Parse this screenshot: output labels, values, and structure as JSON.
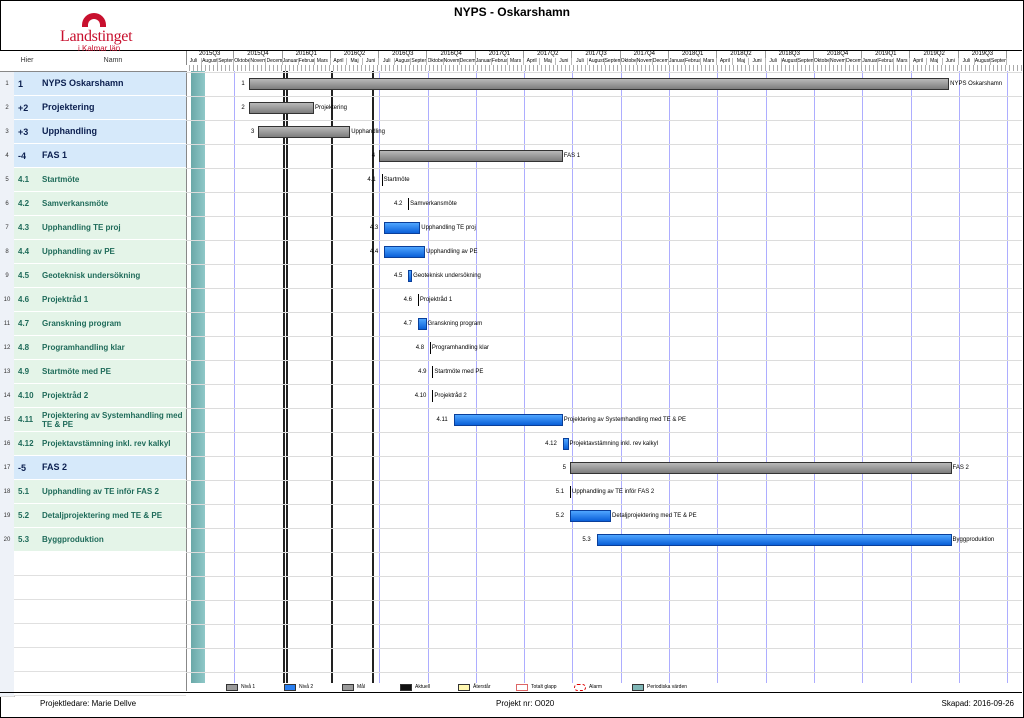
{
  "header": {
    "title": "NYPS - Oskarshamn",
    "logo_name": "Landstinget",
    "logo_sub": "i Kalmar län"
  },
  "columns": {
    "hier": "Hier",
    "name": "Namn"
  },
  "timeline": {
    "quarters": [
      "2015Q3",
      "2015Q4",
      "2016Q1",
      "2016Q2",
      "2016Q3",
      "2016Q4",
      "2017Q1",
      "2017Q2",
      "2017Q3",
      "2017Q4",
      "2018Q1",
      "2018Q2",
      "2018Q3",
      "2018Q4",
      "2019Q1",
      "2019Q2",
      "2019Q3"
    ],
    "months": [
      "Juli",
      "Augusti",
      "September",
      "Oktober",
      "November",
      "December",
      "Januari",
      "Februari",
      "Mars",
      "April",
      "Maj",
      "Juni"
    ]
  },
  "rows": [
    {
      "num": "1",
      "hier": "1",
      "name": "NYPS Oskarshamn",
      "level": 1,
      "expand": ""
    },
    {
      "num": "2",
      "hier": "2",
      "name": "Projektering",
      "level": 1,
      "expand": "+"
    },
    {
      "num": "3",
      "hier": "3",
      "name": "Upphandling",
      "level": 1,
      "expand": "+"
    },
    {
      "num": "4",
      "hier": "4",
      "name": "FAS 1",
      "level": 1,
      "expand": "-"
    },
    {
      "num": "5",
      "hier": "4.1",
      "name": "Startmöte",
      "level": 2,
      "expand": ""
    },
    {
      "num": "6",
      "hier": "4.2",
      "name": "Samverkansmöte",
      "level": 2,
      "expand": ""
    },
    {
      "num": "7",
      "hier": "4.3",
      "name": "Upphandling TE proj",
      "level": 2,
      "expand": ""
    },
    {
      "num": "8",
      "hier": "4.4",
      "name": "Upphandling av PE",
      "level": 2,
      "expand": ""
    },
    {
      "num": "9",
      "hier": "4.5",
      "name": "Geoteknisk undersökning",
      "level": 2,
      "expand": ""
    },
    {
      "num": "10",
      "hier": "4.6",
      "name": "Projektråd 1",
      "level": 2,
      "expand": ""
    },
    {
      "num": "11",
      "hier": "4.7",
      "name": "Granskning program",
      "level": 2,
      "expand": ""
    },
    {
      "num": "12",
      "hier": "4.8",
      "name": "Programhandling klar",
      "level": 2,
      "expand": ""
    },
    {
      "num": "13",
      "hier": "4.9",
      "name": "Startmöte med PE",
      "level": 2,
      "expand": ""
    },
    {
      "num": "14",
      "hier": "4.10",
      "name": "Projektråd 2",
      "level": 2,
      "expand": ""
    },
    {
      "num": "15",
      "hier": "4.11",
      "name": "Projektering av Systemhandling med TE & PE",
      "level": 2,
      "expand": ""
    },
    {
      "num": "16",
      "hier": "4.12",
      "name": "Projektavstämning inkl. rev kalkyl",
      "level": 2,
      "expand": ""
    },
    {
      "num": "17",
      "hier": "5",
      "name": "FAS 2",
      "level": 1,
      "expand": "-"
    },
    {
      "num": "18",
      "hier": "5.1",
      "name": "Upphandling av TE inför FAS 2",
      "level": 2,
      "expand": ""
    },
    {
      "num": "19",
      "hier": "5.2",
      "name": "Detaljprojektering med TE & PE",
      "level": 2,
      "expand": ""
    },
    {
      "num": "20",
      "hier": "5.3",
      "name": "Byggproduktion",
      "level": 2,
      "expand": ""
    }
  ],
  "bars": [
    {
      "id": "1",
      "label": "NYPS Oskarshamn",
      "type": "summary",
      "start_q": 1.3,
      "end_q": 15.8
    },
    {
      "id": "2",
      "label": "Projektering",
      "type": "summary",
      "start_q": 1.3,
      "end_q": 2.65
    },
    {
      "id": "3",
      "label": "Upphandling",
      "type": "summary",
      "start_q": 1.5,
      "end_q": 3.4
    },
    {
      "id": "4",
      "label": "FAS 1",
      "type": "summary",
      "start_q": 4.0,
      "end_q": 7.8
    },
    {
      "id": "4.1",
      "label": "Startmöte",
      "type": "milestone",
      "start_q": 4.05,
      "end_q": 4.05
    },
    {
      "id": "4.2",
      "label": "Samverkansmöte",
      "type": "milestone",
      "start_q": 4.6,
      "end_q": 4.6
    },
    {
      "id": "4.3",
      "label": "Upphandling TE proj",
      "type": "task",
      "start_q": 4.1,
      "end_q": 4.85
    },
    {
      "id": "4.4",
      "label": "Upphandling av PE",
      "type": "task",
      "start_q": 4.1,
      "end_q": 4.95
    },
    {
      "id": "4.5",
      "label": "Geoteknisk undersökning",
      "type": "task",
      "start_q": 4.6,
      "end_q": 4.68
    },
    {
      "id": "4.6",
      "label": "Projektråd 1",
      "type": "milestone",
      "start_q": 4.8,
      "end_q": 4.8
    },
    {
      "id": "4.7",
      "label": "Granskning program",
      "type": "task",
      "start_q": 4.8,
      "end_q": 4.98
    },
    {
      "id": "4.8",
      "label": "Programhandling klar",
      "type": "milestone",
      "start_q": 5.05,
      "end_q": 5.05
    },
    {
      "id": "4.9",
      "label": "Startmöte med PE",
      "type": "milestone",
      "start_q": 5.1,
      "end_q": 5.1
    },
    {
      "id": "4.10",
      "label": "Projektråd 2",
      "type": "milestone",
      "start_q": 5.1,
      "end_q": 5.1
    },
    {
      "id": "4.11",
      "label": "Projektering av Systemhandling med TE & PE",
      "type": "task",
      "start_q": 5.55,
      "end_q": 7.8
    },
    {
      "id": "4.12",
      "label": "Projektavstämning inkl. rev kalkyl",
      "type": "task",
      "start_q": 7.8,
      "end_q": 7.92
    },
    {
      "id": "5",
      "label": "FAS 2",
      "type": "summary",
      "start_q": 7.95,
      "end_q": 15.85
    },
    {
      "id": "5.1",
      "label": "Upphandling av TE inför FAS 2",
      "type": "milestone",
      "start_q": 7.95,
      "end_q": 7.95
    },
    {
      "id": "5.2",
      "label": "Detaljprojektering med TE & PE",
      "type": "task",
      "start_q": 7.95,
      "end_q": 8.8
    },
    {
      "id": "5.3",
      "label": "Byggproduktion",
      "type": "task",
      "start_q": 8.5,
      "end_q": 15.85
    }
  ],
  "legend": [
    {
      "label": "Nivå 1",
      "color": "#9a9a9a"
    },
    {
      "label": "Nivå 2",
      "color": "#2a7ff0"
    },
    {
      "label": "Mål",
      "color": "#9a9a9a"
    },
    {
      "label": "Aktuell",
      "color": "#111111"
    },
    {
      "label": "Återstår",
      "color": "#fff7b0"
    },
    {
      "label": "Totalt glapp",
      "color": "#ffffff"
    },
    {
      "label": "Alarm",
      "color": "#ffffff"
    },
    {
      "label": "Periodiska värden",
      "color": "#7fb6b6"
    }
  ],
  "footer": {
    "project_lead": "Projektledare: Marie Dellve",
    "project_nr": "Projekt nr: O020",
    "created": "Skapad: 2016-09-26"
  },
  "colors": {
    "level1_bg": "#d6e9fa",
    "level2_bg": "#e4f4e8",
    "summary_bar": "#8a8a8a",
    "task_bar": "#1e7cf0"
  }
}
